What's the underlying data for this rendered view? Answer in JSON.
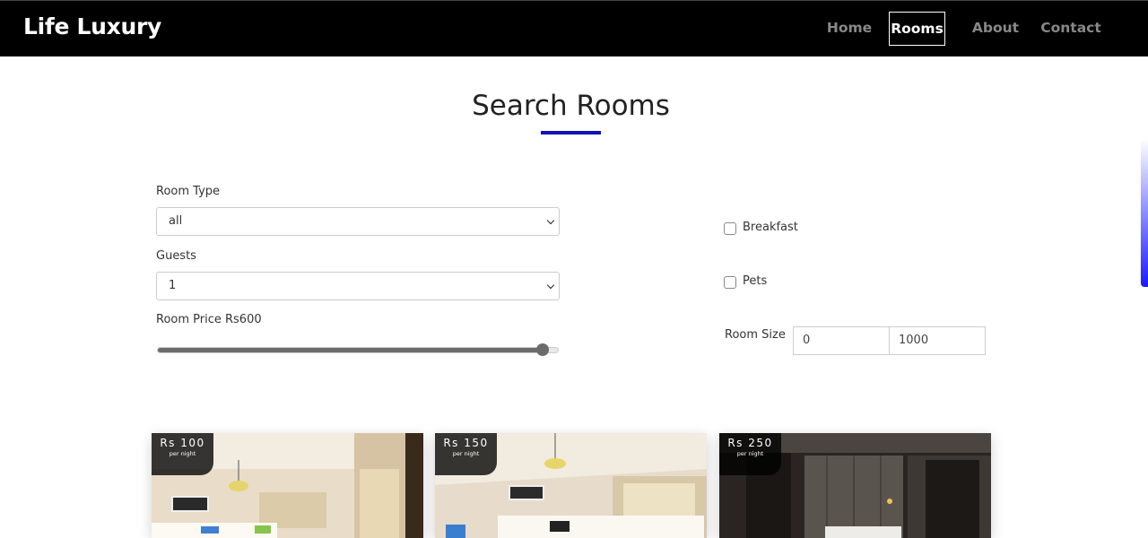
{
  "brand": "Life Luxury",
  "nav": {
    "links": [
      "Home",
      "Rooms",
      "About",
      "Contact"
    ],
    "active": "Rooms"
  },
  "title": "Search Rooms",
  "form": {
    "room_type_label": "Room Type",
    "room_type_value": "all",
    "guests_label": "Guests",
    "guests_value": "1",
    "price_label": "Room Price Rs600",
    "price_fraction": 0.96,
    "breakfast_label": "Breakfast",
    "breakfast_checked": false,
    "pets_label": "Pets",
    "pets_checked": false,
    "size_label": "Room Size",
    "size_min": "0",
    "size_max": "1000"
  },
  "rooms": [
    {
      "price": "Rs 100",
      "per": "per night",
      "theme": "light"
    },
    {
      "price": "Rs 150",
      "per": "per night",
      "theme": "light"
    },
    {
      "price": "Rs 250",
      "per": "per night",
      "theme": "dark"
    }
  ],
  "colors": {
    "navbar_bg": "#000000",
    "accent": "#1212b8",
    "active_nav": "#ffffff",
    "inactive_nav": "#888888"
  }
}
